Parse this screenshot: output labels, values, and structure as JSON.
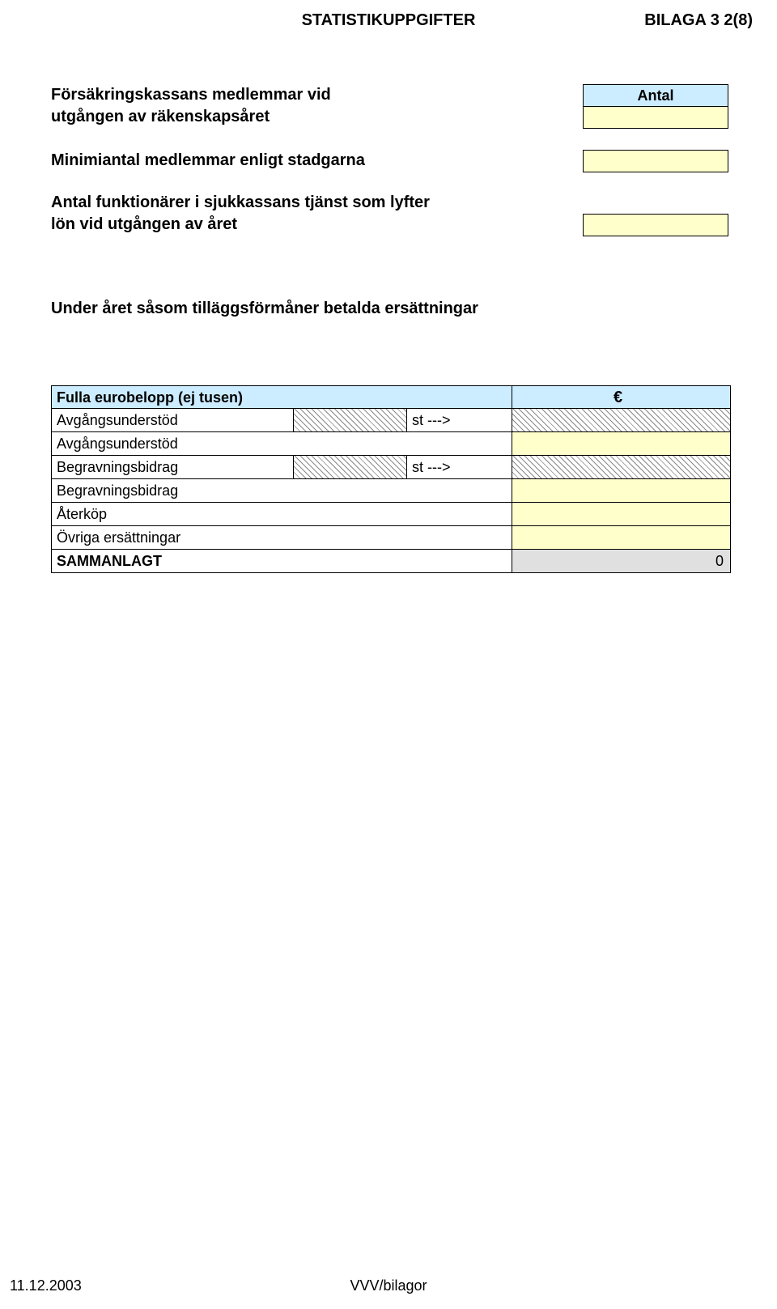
{
  "header": {
    "title": "STATISTIKUPPGIFTER",
    "bilaga": "BILAGA 3  2(8)"
  },
  "antal": {
    "label": "Antal",
    "values": [
      "",
      "",
      ""
    ]
  },
  "labels": {
    "l1a": "Försäkringskassans medlemmar vid",
    "l1b": "utgången av räkenskapsåret",
    "l2": "Minimiantal medlemmar enligt stadgarna",
    "l3a": "Antal funktionärer i sjukkassans tjänst som lyfter",
    "l3b": "lön vid utgången av året"
  },
  "subtitle": "Under året såsom tilläggsförmåner betalda ersättningar",
  "table": {
    "header_left": "Fulla eurobelopp (ej tusen)",
    "header_right": "€",
    "st_marker": "st --->",
    "rows": [
      {
        "label": "Avgångsunderstöd",
        "mid_hatch": true,
        "st": true,
        "amount_hatch": true,
        "amount": ""
      },
      {
        "label": "Avgångsunderstöd",
        "mid_yellow": true,
        "amount_yellow": true,
        "amount": ""
      },
      {
        "label": "Begravningsbidrag",
        "mid_hatch": true,
        "st": true,
        "amount_hatch": true,
        "amount": ""
      },
      {
        "label": "Begravningsbidrag",
        "mid_yellow": true,
        "amount_yellow": true,
        "amount": ""
      },
      {
        "label": "Återköp",
        "wide_label": true,
        "amount_yellow": true,
        "amount": ""
      },
      {
        "label": "Övriga ersättningar",
        "wide_label": true,
        "amount_yellow": true,
        "amount": ""
      }
    ],
    "sum_label": "SAMMANLAGT",
    "sum_value": "0"
  },
  "footer": {
    "left": "11.12.2003",
    "center": "VVV/bilagor"
  }
}
